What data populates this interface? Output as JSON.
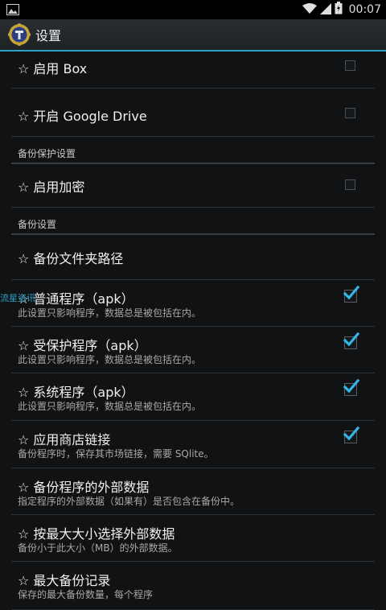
{
  "status_bar": {
    "time": "00:07"
  },
  "app": {
    "title": "设置"
  },
  "overlay": {
    "text": "流星资讯"
  },
  "rows": [
    {
      "title": "☆ 启用 Box",
      "checked": false
    },
    {
      "title": "☆ 开启 Google Drive",
      "checked": false
    },
    {
      "category": "备份保护设置"
    },
    {
      "title": "☆ 启用加密",
      "checked": false
    },
    {
      "category": "备份设置"
    },
    {
      "title": "☆ 备份文件夹路径"
    },
    {
      "title": "☆ 普通程序（apk）",
      "summary": "此设置只影响程序，数据总是被包括在内。",
      "checked": true
    },
    {
      "title": "☆ 受保护程序（apk）",
      "summary": "此设置只影响程序，数据总是被包括在内。",
      "checked": true
    },
    {
      "title": "☆ 系统程序（apk）",
      "summary": "此设置只影响程序，数据总是被包括在内。",
      "checked": true
    },
    {
      "title": "☆ 应用商店链接",
      "summary": "备份程序时，保存其市场链接，需要 SQlite。",
      "checked": true
    },
    {
      "title": "☆ 备份程序的外部数据",
      "summary": "指定程序的外部数据（如果有）是否包含在备份中。"
    },
    {
      "title": "☆ 按最大大小选择外部数据",
      "summary": "备份小于此大小（MB）的外部数据。"
    },
    {
      "title": "☆ 最大备份记录",
      "summary": "保存的最大备份数量，每个程序"
    }
  ]
}
